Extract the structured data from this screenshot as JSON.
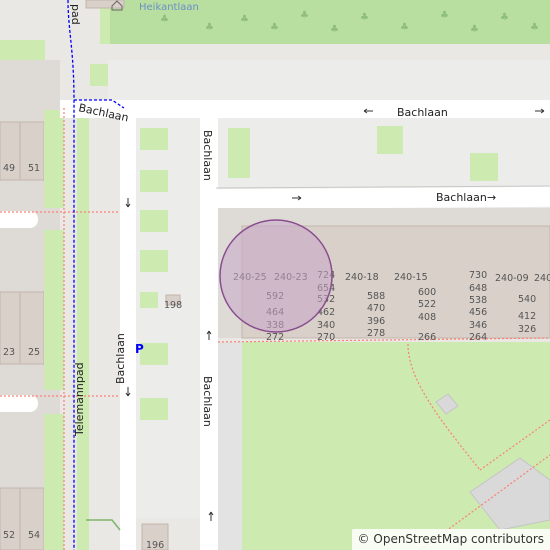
{
  "streets": {
    "bachlaan_top": "Bachlaan",
    "bachlaan_top_small": "Bachlaan",
    "bachlaan_mid": "Bachlaan",
    "bachlaan_vertical_upper": "Bachlaan",
    "bachlaan_vertical_left": "Bachlaan",
    "bachlaan_vertical_lower": "Bachlaan",
    "telemannpad": "Telemannpad",
    "pad_top": "pad"
  },
  "poi": {
    "heikantlaan": "Heikantlaan"
  },
  "house_numbers": {
    "left": [
      "49",
      "51",
      "23",
      "25",
      "52",
      "54"
    ],
    "lane": [
      "198",
      "196"
    ],
    "block": [
      "240-25",
      "240-23",
      "724",
      "654",
      "592",
      "532",
      "464",
      "462",
      "338",
      "340",
      "272",
      "270",
      "240-18",
      "588",
      "470",
      "396",
      "278",
      "240-15",
      "600",
      "522",
      "408",
      "266",
      "730",
      "648",
      "538",
      "456",
      "346",
      "264",
      "240-09",
      "540",
      "412",
      "326",
      "240"
    ]
  },
  "attribution": {
    "symbol": "©",
    "text": "OpenStreetMap contributors"
  },
  "colors": {
    "road": "#ffffff",
    "building": "#d9d0c9",
    "building_outline": "#c4b6ab",
    "grass": "#cdebb0",
    "park_dark": "#a9d6a0",
    "footway": "#fa8072",
    "parking": "#0000ff",
    "marker_stroke": "#8a4d8f",
    "marker_fill": "#c6a6c8"
  },
  "marker": {
    "shape": "circle"
  },
  "icons": {
    "parking": "P"
  }
}
